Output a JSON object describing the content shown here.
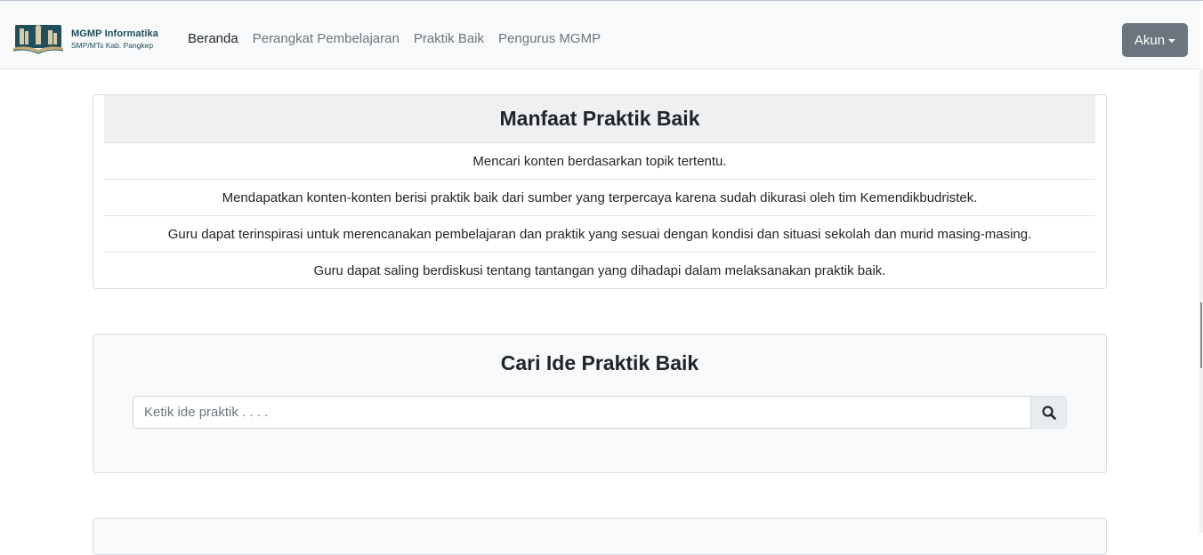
{
  "brand": {
    "title": "MGMP Informatika",
    "subtitle": "SMP/MTs Kab. Pangkep"
  },
  "nav": {
    "items": [
      "Beranda",
      "Perangkat Pembelajaran",
      "Praktik Baik",
      "Pengurus MGMP"
    ],
    "active_index": 0
  },
  "account": {
    "label": "Akun"
  },
  "benefits": {
    "title": "Manfaat Praktik Baik",
    "items": [
      "Mencari konten berdasarkan topik tertentu.",
      "Mendapatkan konten-konten berisi praktik baik dari sumber yang terpercaya karena sudah dikurasi oleh tim Kemendikbudristek.",
      "Guru dapat terinspirasi untuk merencanakan pembelajaran dan praktik yang sesuai dengan kondisi dan situasi sekolah dan murid masing-masing.",
      "Guru dapat saling berdiskusi tentang tantangan yang dihadapi dalam melaksanakan praktik baik."
    ]
  },
  "search": {
    "title": "Cari Ide Praktik Baik",
    "placeholder": "Ketik ide praktik . . . .",
    "value": "",
    "button_icon": "search-icon"
  },
  "colors": {
    "navbar_bg": "#f8f9fa",
    "account_button": "#6c757d",
    "brand_text": "#1c4e5a",
    "card_header_bg": "#eff0f1"
  }
}
